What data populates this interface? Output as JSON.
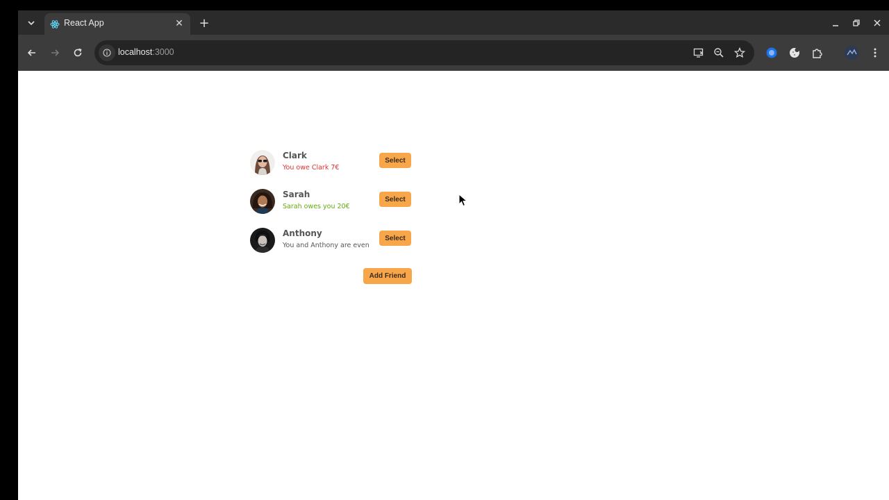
{
  "browser": {
    "tab": {
      "title": "React App",
      "favicon": "react-icon"
    },
    "address": {
      "host": "localhost",
      "port": ":3000"
    },
    "icons": {
      "tab_list": "chevron-down-icon",
      "tab_close": "close-icon",
      "new_tab": "plus-icon",
      "back": "arrow-left-icon",
      "forward": "arrow-right-icon",
      "reload": "reload-icon",
      "site_info": "info-icon",
      "cast": "cast-icon",
      "zoom": "zoom-icon",
      "bookmark": "star-icon",
      "extensions": [
        "blue-circle-extension-icon",
        "cookie-extension-icon",
        "puzzle-icon"
      ],
      "profile": "profile-avatar-icon",
      "menu": "kebab-menu-icon"
    }
  },
  "friends": [
    {
      "name": "Clark",
      "status": "You owe Clark 7€",
      "status_color": "#e03131",
      "button": "Select"
    },
    {
      "name": "Sarah",
      "status": "Sarah owes you 20€",
      "status_color": "#66a80f",
      "button": "Select"
    },
    {
      "name": "Anthony",
      "status": "You and Anthony are even",
      "status_color": "#555555",
      "button": "Select"
    }
  ],
  "add_friend_button": "Add Friend",
  "colors": {
    "accent": "#f7a64a",
    "page_bg": "#ffffff",
    "toolbar": "#3c3c3c",
    "tabbar": "#2b2b2b"
  }
}
